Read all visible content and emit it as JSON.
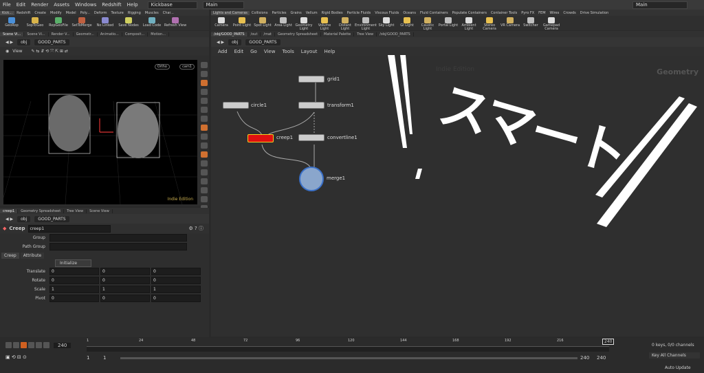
{
  "menu": [
    "File",
    "Edit",
    "Render",
    "Assets",
    "Windows",
    "Redshift",
    "Help"
  ],
  "desktop": "Kickbase",
  "main_desk": "Main",
  "main_desk_right": "Main",
  "left_shelf_tabs": [
    "Kick...",
    "Redshift",
    "Create",
    "Modify",
    "Model",
    "Poly...",
    "Deform",
    "Texture",
    "Rigging",
    "Muscles",
    "Char..."
  ],
  "left_tools": [
    "GeoRop",
    "SopToGeo",
    "RopGeoFile",
    "SetToMerge",
    "No Linked",
    "Save Nodes",
    "Load Code",
    "Refresh View"
  ],
  "right_shelf_tabs": [
    "Lights and Cameras",
    "Collisions",
    "Particles",
    "Grains",
    "Vellum",
    "Rigid Bodies",
    "Particle Fluids",
    "Viscous Fluids",
    "Oceans",
    "Fluid Containers",
    "Populate Containers",
    "Container Tools",
    "Pyro FX",
    "FEM",
    "Wires",
    "Crowds",
    "Drive Simulation"
  ],
  "right_tools": [
    "Camera",
    "Point Light",
    "Spot Light",
    "Area Light",
    "Geometry Light",
    "Volume Light",
    "Distant Light",
    "Environment Light",
    "Sky Light",
    "GI Light",
    "Caustic Light",
    "Portal Light",
    "Ambient Light",
    "Stereo Camera",
    "VR Camera",
    "Switcher",
    "Gamepad Camera"
  ],
  "left_pane_tabs": [
    "Scene Vi...",
    "Scene Vi...",
    "Render V...",
    "Geometr...",
    "Animatio...",
    "Composit...",
    "Motion..."
  ],
  "right_pane_tabs": [
    "/obj/GOOD_PARTS",
    "/out",
    "/mat",
    "Geometry Spreadsheet",
    "Material Palette",
    "Tree View",
    "/obj/GOOD_PARTS"
  ],
  "path": {
    "obj": "obj",
    "node": "GOOD_PARTS"
  },
  "viewport": {
    "title": "View",
    "persp": "Ortho",
    "cam": "cam1",
    "watermark": "Indie Edition"
  },
  "network": {
    "menu": [
      "Add",
      "Edit",
      "Go",
      "View",
      "Tools",
      "Layout",
      "Help"
    ],
    "watermark": "Indie Edition",
    "context": "Geometry",
    "nodes": {
      "grid": "grid1",
      "circle": "circle1",
      "transform": "transform1",
      "creep": "creep1",
      "convert": "convertline1",
      "merge": "merge1"
    },
    "overlay": "スマート"
  },
  "param_tabs": [
    "creep1",
    "Geometry Spreadsheet",
    "Tree View",
    "Scene View"
  ],
  "params": {
    "type": "Creep",
    "name": "creep1",
    "group_label": "Group",
    "pathgroup_label": "Path Group",
    "tabs": [
      "Creep",
      "Attribute"
    ],
    "init": "Initialize",
    "rows": [
      {
        "label": "Translate",
        "v": [
          "0",
          "0",
          "0"
        ]
      },
      {
        "label": "Rotate",
        "v": [
          "0",
          "0",
          "0"
        ]
      },
      {
        "label": "Scale",
        "v": [
          "1",
          "1",
          "1"
        ]
      },
      {
        "label": "Pivot",
        "v": [
          "0",
          "0",
          "0"
        ]
      }
    ]
  },
  "timeline": {
    "frame": "240",
    "ticks": [
      "1",
      "24",
      "48",
      "72",
      "96",
      "120",
      "144",
      "168",
      "192",
      "216"
    ],
    "end_marker": "240",
    "start": "1",
    "start2": "1",
    "end": "240",
    "end2": "240",
    "keys": "0 keys, 0/0 channels",
    "key_all": "Key All Channels",
    "auto": "Auto Update"
  }
}
